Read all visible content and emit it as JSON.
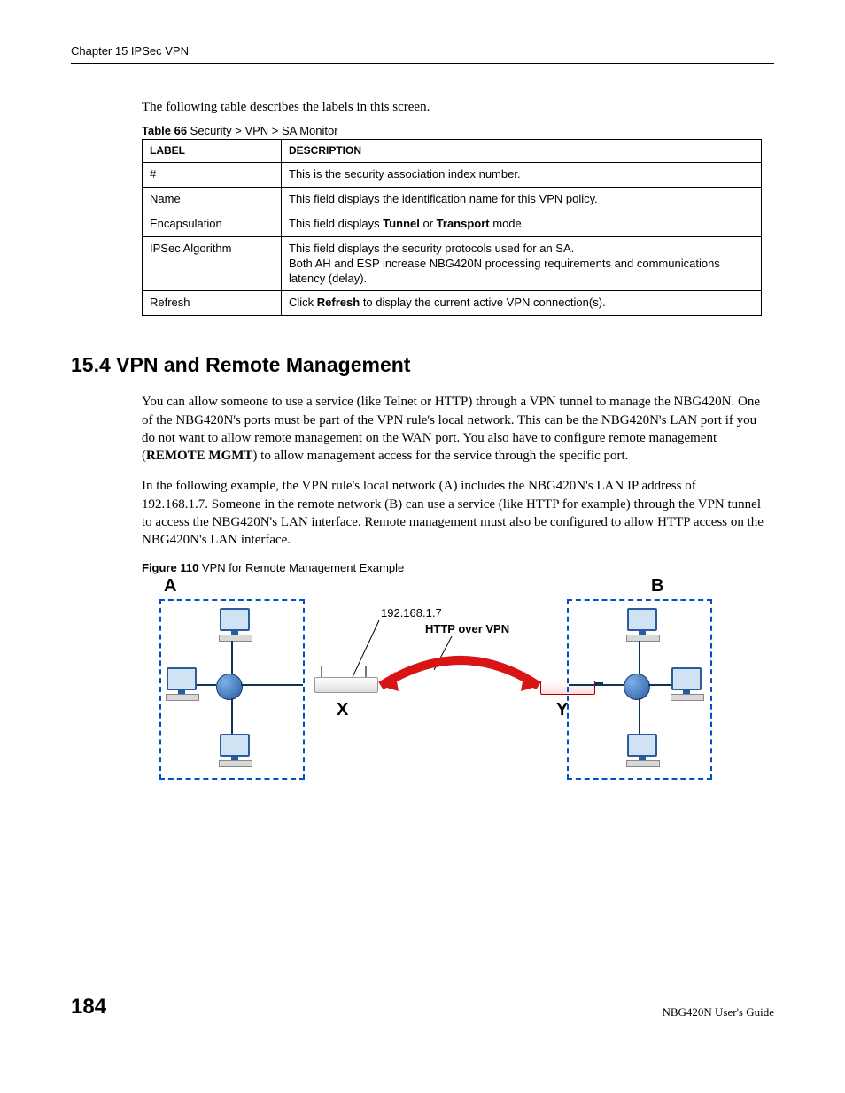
{
  "header": "Chapter 15 IPSec VPN",
  "intro": "The following table describes the labels in this screen.",
  "table_caption_prefix": "Table 66",
  "table_caption_text": "   Security > VPN > SA Monitor",
  "table": {
    "col1": "LABEL",
    "col2": "DESCRIPTION",
    "rows": [
      {
        "label": "#",
        "desc": "This is the security association index number."
      },
      {
        "label": "Name",
        "desc": "This field displays the identification name for this VPN policy."
      },
      {
        "label": "Encapsulation",
        "desc_pre": "This field displays ",
        "b1": "Tunnel",
        "mid": " or ",
        "b2": "Transport",
        "desc_post": " mode."
      },
      {
        "label": "IPSec Algorithm",
        "desc": "This field displays the security protocols used for an SA.\nBoth AH and ESP increase NBG420N processing requirements and communications latency (delay)."
      },
      {
        "label": "Refresh",
        "desc_pre": "Click ",
        "b1": "Refresh",
        "desc_post": " to display the current active VPN connection(s)."
      }
    ]
  },
  "section_heading": "15.4  VPN and Remote Management",
  "para1_a": "You can allow someone to use a service (like Telnet or HTTP) through a VPN tunnel to manage the NBG420N. One of the NBG420N's ports must be part of the VPN rule's local network. This can be the NBG420N's LAN port if you do not want to allow remote management on the WAN port. You also have to configure remote management (",
  "para1_b": "REMOTE MGMT",
  "para1_c": ") to allow management access for the service through the specific port.",
  "para2": "In the following example, the VPN rule's local network (A) includes the NBG420N's LAN IP address of 192.168.1.7. Someone in the remote network (B) can use a service (like HTTP for example) through the VPN tunnel to access the NBG420N's LAN interface. Remote management must also be configured to allow HTTP access on the NBG420N's LAN interface.",
  "figure_caption_prefix": "Figure 110",
  "figure_caption_text": "   VPN for Remote Management Example",
  "diagram": {
    "labelA": "A",
    "labelB": "B",
    "labelX": "X",
    "labelY": "Y",
    "ip": "192.168.1.7",
    "http": "HTTP over VPN"
  },
  "page_number": "184",
  "guide": "NBG420N User's Guide"
}
